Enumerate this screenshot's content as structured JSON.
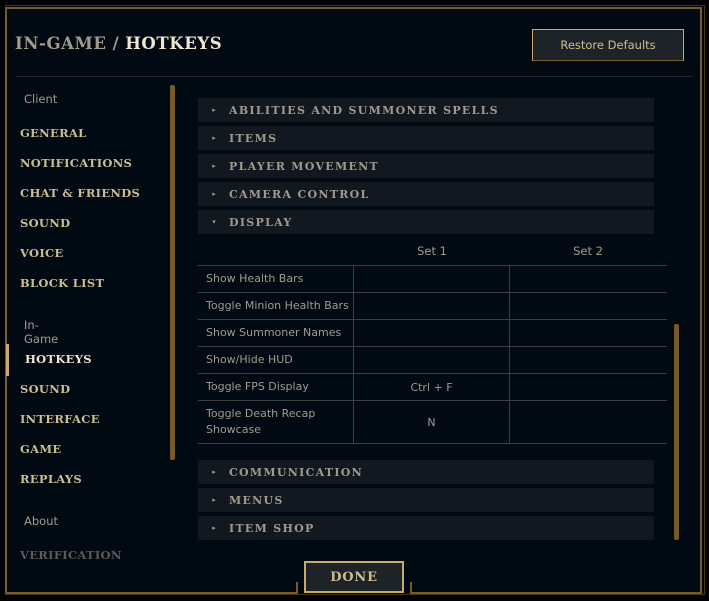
{
  "header": {
    "breadcrumb_parent": "IN-GAME",
    "breadcrumb_separator": "/",
    "breadcrumb_current": "HOTKEYS",
    "restore_defaults_label": "Restore Defaults"
  },
  "sidebar": {
    "client_section": "Client",
    "client_items": [
      "GENERAL",
      "NOTIFICATIONS",
      "CHAT & FRIENDS",
      "SOUND",
      "VOICE",
      "BLOCK LIST"
    ],
    "ingame_section": "In-Game",
    "ingame_items": [
      "HOTKEYS",
      "SOUND",
      "INTERFACE",
      "GAME",
      "REPLAYS"
    ],
    "active_item": "HOTKEYS",
    "about_section": "About",
    "about_items": [
      "VERIFICATION"
    ]
  },
  "sections_above": [
    {
      "label": "ABILITIES AND SUMMONER SPELLS",
      "expanded": false,
      "icon": "triangle-right-icon"
    },
    {
      "label": "ITEMS",
      "expanded": false,
      "icon": "triangle-right-icon"
    },
    {
      "label": "PLAYER MOVEMENT",
      "expanded": false,
      "icon": "triangle-right-icon"
    },
    {
      "label": "CAMERA CONTROL",
      "expanded": false,
      "icon": "triangle-right-icon"
    },
    {
      "label": "DISPLAY",
      "expanded": true,
      "icon": "triangle-down-icon"
    }
  ],
  "display_table": {
    "columns": [
      "Set 1",
      "Set 2"
    ],
    "rows": [
      {
        "name": "Show Health Bars",
        "set1": "",
        "set2": ""
      },
      {
        "name": "Toggle Minion Health Bars",
        "set1": "",
        "set2": ""
      },
      {
        "name": "Show Summoner Names",
        "set1": "",
        "set2": ""
      },
      {
        "name": "Show/Hide HUD",
        "set1": "",
        "set2": ""
      },
      {
        "name": "Toggle FPS Display",
        "set1": "Ctrl + F",
        "set2": ""
      },
      {
        "name": "Toggle Death Recap Showcase",
        "set1": "N",
        "set2": ""
      }
    ]
  },
  "sections_below": [
    {
      "label": "COMMUNICATION",
      "expanded": false,
      "icon": "triangle-right-icon"
    },
    {
      "label": "MENUS",
      "expanded": false,
      "icon": "triangle-right-icon"
    },
    {
      "label": "ITEM SHOP",
      "expanded": false,
      "icon": "triangle-right-icon"
    }
  ],
  "icons": {
    "collapsed": "▸",
    "expanded": "▾"
  },
  "footer": {
    "done_label": "DONE"
  },
  "colors": {
    "background": "#010a13",
    "gold_border": "#785a28",
    "gold_bright": "#c8aa6e",
    "text_gold": "#cdbe91",
    "text_muted": "#a09b8c",
    "text_active": "#f0e6d2",
    "section_bg": "#111820"
  }
}
